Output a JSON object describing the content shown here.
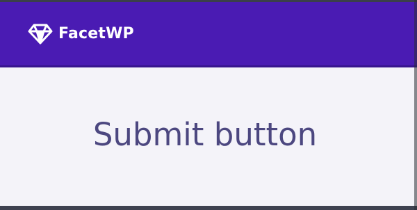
{
  "header": {
    "brand_name": "FacetWP",
    "logo_icon": "diamond-icon",
    "background_color": "#4a1bb3"
  },
  "main": {
    "title": "Submit button",
    "title_color": "#4c4780",
    "background_color": "#f4f3f9"
  }
}
